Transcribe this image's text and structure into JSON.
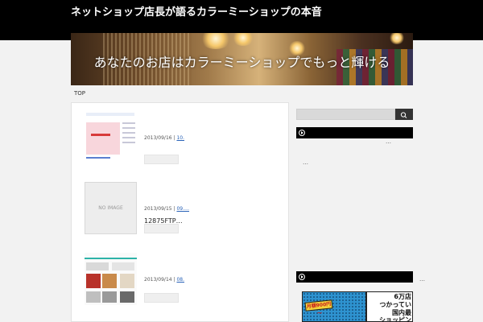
{
  "header": {
    "site_title": "ネットショップ店長が語るカラーミーショップの本音",
    "banner_text": "あなたのお店はカラーミーショップでもっと輝ける"
  },
  "breadcrumb": {
    "top": "TOP"
  },
  "posts": [
    {
      "date": "2013/09/16",
      "separator": "|",
      "link": "10.",
      "title": "",
      "thumb": "screenshot"
    },
    {
      "date": "2013/09/15",
      "separator": "|",
      "link": "09.…",
      "title": "12875FTP…",
      "thumb": "no-image",
      "no_image_label": "NO IMAGE"
    },
    {
      "date": "2013/09/14",
      "separator": "|",
      "link": "08.",
      "title": "",
      "thumb": "screenshot"
    }
  ],
  "sidebar": {
    "widget_1_more": "…",
    "widget_1_item": "…",
    "widget_2_more": "…",
    "ad": {
      "price_tag": "月額900円～",
      "line1": "6万店",
      "line2": "つかってい",
      "line3": "国内最",
      "line4": "ショッピン"
    }
  },
  "colors": {
    "header_bg": "#000000",
    "page_bg": "#f2f2f2",
    "link": "#2a63b8"
  },
  "icons": {
    "search_button": "search-icon",
    "widget_bullet": "play-circle-icon"
  }
}
